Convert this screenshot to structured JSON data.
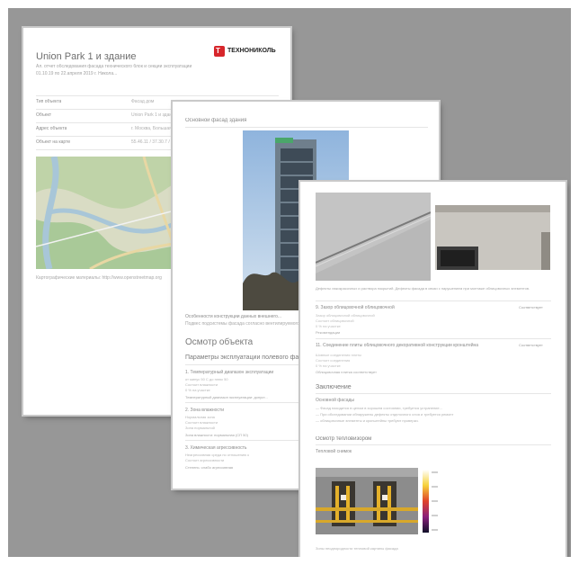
{
  "page1": {
    "title": "Union Park 1 и здание",
    "subtitle1": "Ал. отчет обследования фасада технического блок и секции эксплуатации",
    "subtitle2": "01.10.19 по 22.апреля 2019 г. Никола...",
    "brand": "ТЕХНОНИКОЛЬ",
    "table": [
      {
        "k": "Тип объекта",
        "v": "Фасад дом"
      },
      {
        "k": "Объект",
        "v": "Union Park 1 и здание"
      },
      {
        "k": "Адрес объекта",
        "v": "г. Москва, Большая Никитская"
      },
      {
        "k": "Объект на карте",
        "v": "55.46.11 / 37.30.7 / 47.1"
      }
    ],
    "map_caption": "Картографические материалы: http://www.openstreetmap.org"
  },
  "page2": {
    "photo_label": "Основной фасад здания",
    "text1": "Особенности конструкции данных внешнего...",
    "text2": "Подвес подсистемы фасада согласно вентилируемого...",
    "section": "Осмотр объекта",
    "subsection": "Параметры эксплуатации полевого фа...",
    "items": [
      {
        "title": "1. Температурный диапазон эксплуатации",
        "lines": [
          "от минус 50 С до плюс 50",
          "Состоит влажности",
          "0 % на участке",
          "Температурный диапазон эксплуатации: допуст..."
        ]
      },
      {
        "title": "2. Зона влажности",
        "lines": [
          "Нормальная зона",
          "Состоит влажности",
          "Зона нормальной",
          "Зона влажности: нормальная (СП 50)"
        ]
      },
      {
        "title": "3. Химическая агрессивность",
        "lines": [
          "Неагрессивная среда по отношению к",
          "Состоит агрессивности",
          "Степень: слабо агрессивная"
        ]
      }
    ]
  },
  "page3": {
    "caption": "Дефекты лакокрасочных и раствора покрытий. Дефекты фасада в связи с нарушением при монтаже облицовочных элементов.",
    "item1_title": "9. Зазор облицовочной облицовочной",
    "item1_badge": "Соответствует",
    "item1_lines": [
      "Зазор облицовочной облицовочной",
      "Состоит облицовочной",
      "0 % на участке",
      "Рекомендации"
    ],
    "item2_title": "11. Соединение плиты облицовочного декоративной конструкции кронштейна",
    "item2_badge": "Соответствует",
    "item2_lines": [
      "Шовные соединения плиты",
      "Состоит соединения",
      "0 % на участке",
      "Облицовочная плитка соответствует"
    ],
    "conclusion": "Заключение",
    "conclusion_sub": "Основной фасады",
    "conclusion_lines": [
      "— Фасад находится в целом в хорошем состоянии, требуется устранение...",
      "— При обследовании обнаружены дефекты отделочного слоя и требуется ремонт",
      "— облицовочные элементы и кронштейны требуют проверки."
    ],
    "thermal_title": "Осмотр тепловизором",
    "thermal_sub": "Тепловой снимок",
    "thermal_note": "Зоны неоднородности тепловой картины фасада"
  }
}
